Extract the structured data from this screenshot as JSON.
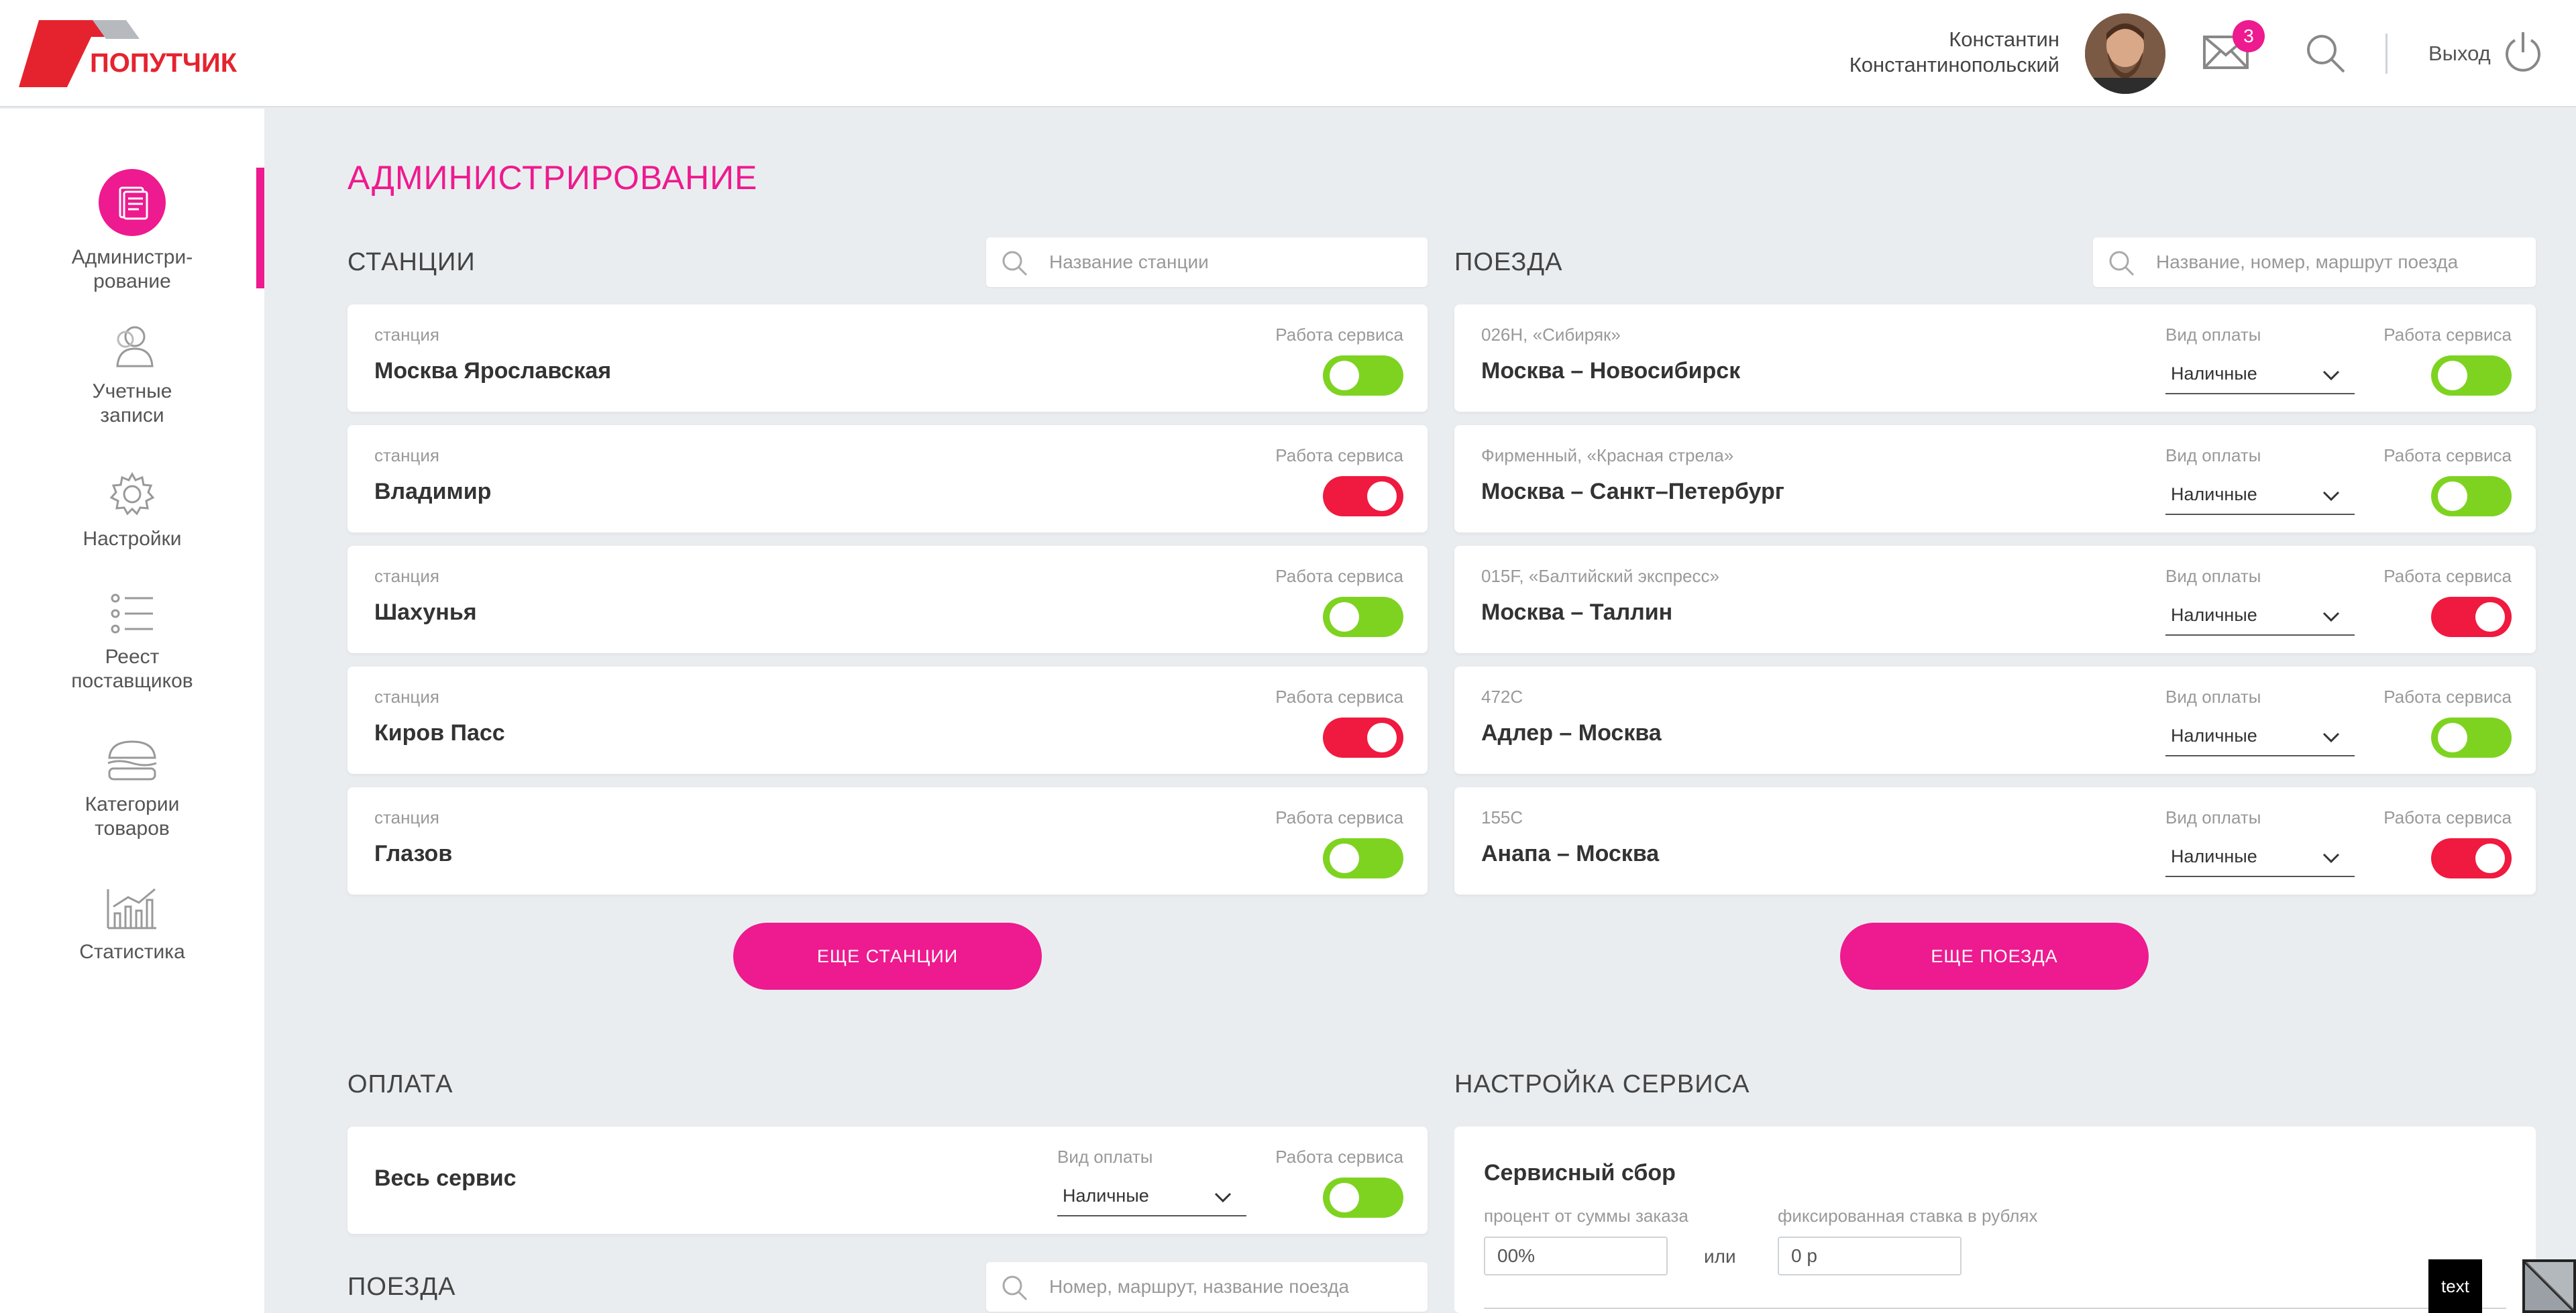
{
  "header": {
    "logo_text": "ПОПУТЧИК",
    "user_first": "Константин",
    "user_last": "Константинопольский",
    "mail_count": "3",
    "logout_label": "Выход"
  },
  "sidebar": {
    "items": [
      {
        "label": "Администри-\nрование",
        "line1": "Администри-",
        "line2": "рование",
        "icon": "admin-icon",
        "active": true
      },
      {
        "label": "Учетные записи",
        "line1": "Учетные",
        "line2": "записи",
        "icon": "users-icon"
      },
      {
        "label": "Настройки",
        "line1": "Настройки",
        "line2": "",
        "icon": "gear-icon"
      },
      {
        "label": "Реест поставщиков",
        "line1": "Реест",
        "line2": "поставщиков",
        "icon": "list-icon"
      },
      {
        "label": "Категории товаров",
        "line1": "Категории",
        "line2": "товаров",
        "icon": "burger-icon"
      },
      {
        "label": "Статистика",
        "line1": "Статистика",
        "line2": "",
        "icon": "chart-icon"
      }
    ],
    "accent_color": "#ee1a8f"
  },
  "main": {
    "page_title": "АДМИНИСТРИРОВАНИЕ",
    "stations": {
      "title": "СТАНЦИИ",
      "search_placeholder": "Название станции",
      "service_label": "Работа сервиса",
      "items": [
        {
          "sub": "станция",
          "name": "Москва Ярославская",
          "service_on": true
        },
        {
          "sub": "станция",
          "name": "Владимир",
          "service_on": false
        },
        {
          "sub": "станция",
          "name": "Шахунья",
          "service_on": true
        },
        {
          "sub": "станция",
          "name": "Киров Пасс",
          "service_on": false
        },
        {
          "sub": "станция",
          "name": "Глазов",
          "service_on": true
        }
      ],
      "more_label": "ЕЩЕ СТАНЦИИ"
    },
    "trains": {
      "title": "ПОЕЗДА",
      "search_placeholder": "Название, номер, маршрут поезда",
      "payment_label": "Вид оплаты",
      "service_label": "Работа сервиса",
      "items": [
        {
          "sub": "026Н, «Сибиряк»",
          "name": "Москва – Новосибирск",
          "payment": "Наличные",
          "service_on": true
        },
        {
          "sub": "Фирменный, «Красная стрела»",
          "name": "Москва – Санкт–Петербург",
          "payment": "Наличные",
          "service_on": true
        },
        {
          "sub": "015F, «Балтийский экспресс»",
          "name": "Москва – Таллин",
          "payment": "Наличные",
          "service_on": false
        },
        {
          "sub": "472С",
          "name": "Адлер – Москва",
          "payment": "Наличные",
          "service_on": true
        },
        {
          "sub": "155С",
          "name": "Анапа – Москва",
          "payment": "Наличные",
          "service_on": false
        }
      ],
      "more_label": "ЕЩЕ ПОЕЗДА"
    },
    "payment": {
      "title": "ОПЛАТА",
      "row_name": "Весь сервис",
      "payment_label": "Вид оплаты",
      "payment_value": "Наличные",
      "service_label": "Работа сервиса",
      "service_on": true
    },
    "trains2": {
      "title": "ПОЕЗДА",
      "search_placeholder": "Номер, маршрут, название поезда"
    },
    "service_settings": {
      "title": "НАСТРОЙКА СЕРВИСА",
      "card_title": "Сервисный сбор",
      "percent_label": "процент от суммы заказа",
      "percent_value": "00%",
      "or_label": "или",
      "fixed_label": "фиксированная ставка в рублях",
      "fixed_value": "0 р"
    }
  },
  "overlay": {
    "text_badge": "text"
  },
  "colors": {
    "toggle_on": "#7ed321",
    "toggle_off": "#f0193f",
    "background": "#eaedf0"
  }
}
